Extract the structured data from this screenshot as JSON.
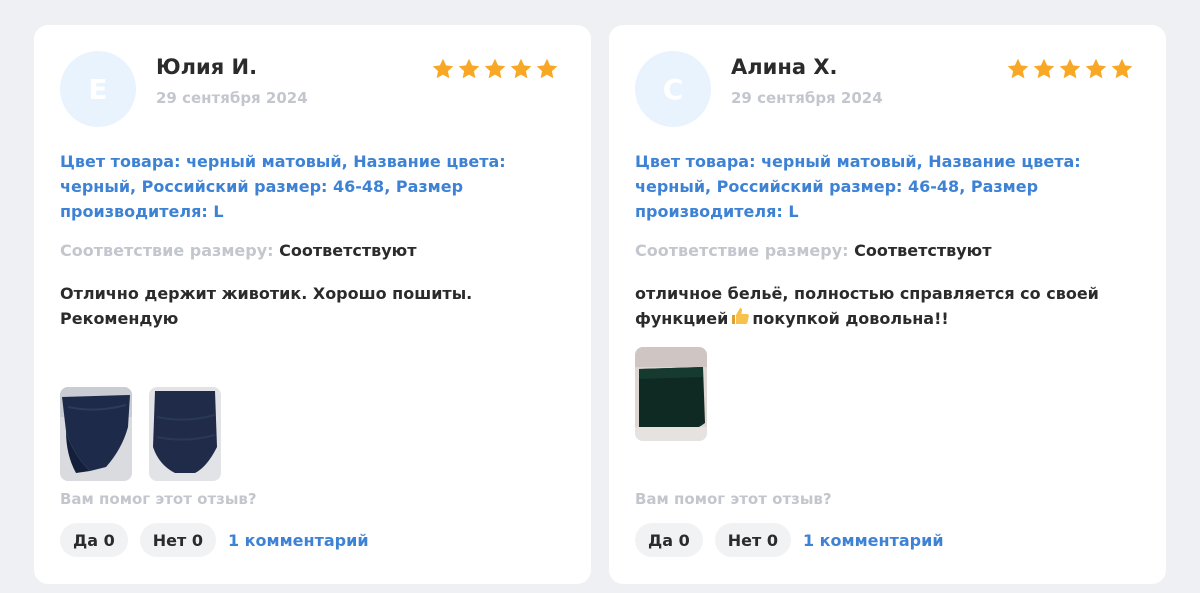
{
  "colors": {
    "accent": "#3d82d4",
    "star": "#f9a825",
    "muted": "#c3c7cd",
    "text": "#2b2b2b",
    "avatar_bg": "#e8f3fd"
  },
  "reviews": [
    {
      "avatar_letter": "Е",
      "author": "Юлия И.",
      "date": "29 сентября 2024",
      "rating": 5,
      "specs": "Цвет товара: черный матовый, Название цвета: черный, Российский размер: 46-48, Размер производителя: L",
      "fit_label": "Соответствие размеру:",
      "fit_value": "Соответствуют",
      "text_parts": [
        "Отлично держит животик. Хорошо пошиты. Рекомендую"
      ],
      "photos_count": 2,
      "helpful_question": "Вам помог этот отзыв?",
      "yes_label": "Да 0",
      "no_label": "Нет 0",
      "comments_label": "1 комментарий"
    },
    {
      "avatar_letter": "С",
      "author": "Алина Х.",
      "date": "29 сентября 2024",
      "rating": 5,
      "specs": "Цвет товара: черный матовый, Название цвета: черный, Российский размер: 46-48, Размер производителя: L",
      "fit_label": "Соответствие размеру:",
      "fit_value": "Соответствуют",
      "text_parts": [
        "отличное бельё, полностью справляется со своей функцией",
        "покупкой довольна!!"
      ],
      "text_icon": "thumbs-up-icon",
      "photos_count": 1,
      "helpful_question": "Вам помог этот отзыв?",
      "yes_label": "Да 0",
      "no_label": "Нет 0",
      "comments_label": "1 комментарий"
    }
  ]
}
